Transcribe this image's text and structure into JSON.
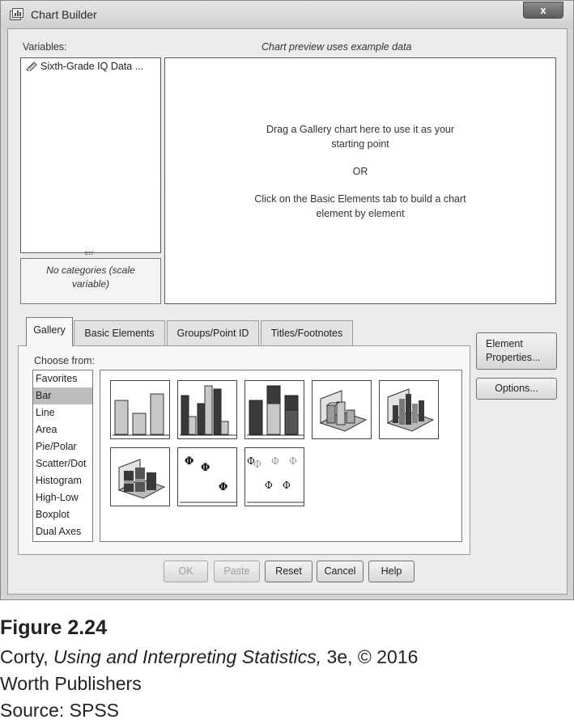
{
  "window": {
    "title": "Chart Builder",
    "close_glyph": "x"
  },
  "variables": {
    "label": "Variables:",
    "items": [
      {
        "name": "Sixth-Grade IQ Data ...",
        "icon": "scale-ruler-icon"
      }
    ],
    "categories_note": "No categories (scale variable)"
  },
  "preview": {
    "caption": "Chart preview uses example data",
    "line1a": "Drag a Gallery chart here to use it as your",
    "line1b": "starting point",
    "or": "OR",
    "line2a": "Click on the Basic Elements tab to build a chart",
    "line2b": "element by element"
  },
  "tabs": [
    {
      "label": "Gallery",
      "active": true
    },
    {
      "label": "Basic Elements",
      "active": false
    },
    {
      "label": "Groups/Point ID",
      "active": false
    },
    {
      "label": "Titles/Footnotes",
      "active": false
    }
  ],
  "gallery": {
    "choose_label": "Choose from:",
    "chart_types": [
      "Favorites",
      "Bar",
      "Line",
      "Area",
      "Pie/Polar",
      "Scatter/Dot",
      "Histogram",
      "High-Low",
      "Boxplot",
      "Dual Axes"
    ],
    "selected": "Bar",
    "thumbnails": [
      "simple-bar-thumbnail",
      "clustered-bar-thumbnail",
      "stacked-bar-thumbnail",
      "3d-bar-thumbnail",
      "3d-clustered-bar-thumbnail",
      "3d-stacked-bar-thumbnail",
      "simple-error-bar-thumbnail",
      "clustered-error-bar-thumbnail"
    ]
  },
  "side_buttons": {
    "element_properties_1": "Element",
    "element_properties_2": "Properties...",
    "options": "Options..."
  },
  "buttons": {
    "ok": "OK",
    "paste": "Paste",
    "reset": "Reset",
    "cancel": "Cancel",
    "help": "Help"
  },
  "caption": {
    "figure": "Figure 2.24",
    "line1_author": "Corty, ",
    "line1_book": "Using and Interpreting Statistics,",
    "line1_rest": " 3e, © 2016",
    "line2": "Worth Publishers",
    "line3": "Source: SPSS"
  },
  "colors": {
    "bar_light": "#c8c8c8",
    "bar_dark": "#3a3a3a",
    "window_bg": "#ebebeb"
  }
}
